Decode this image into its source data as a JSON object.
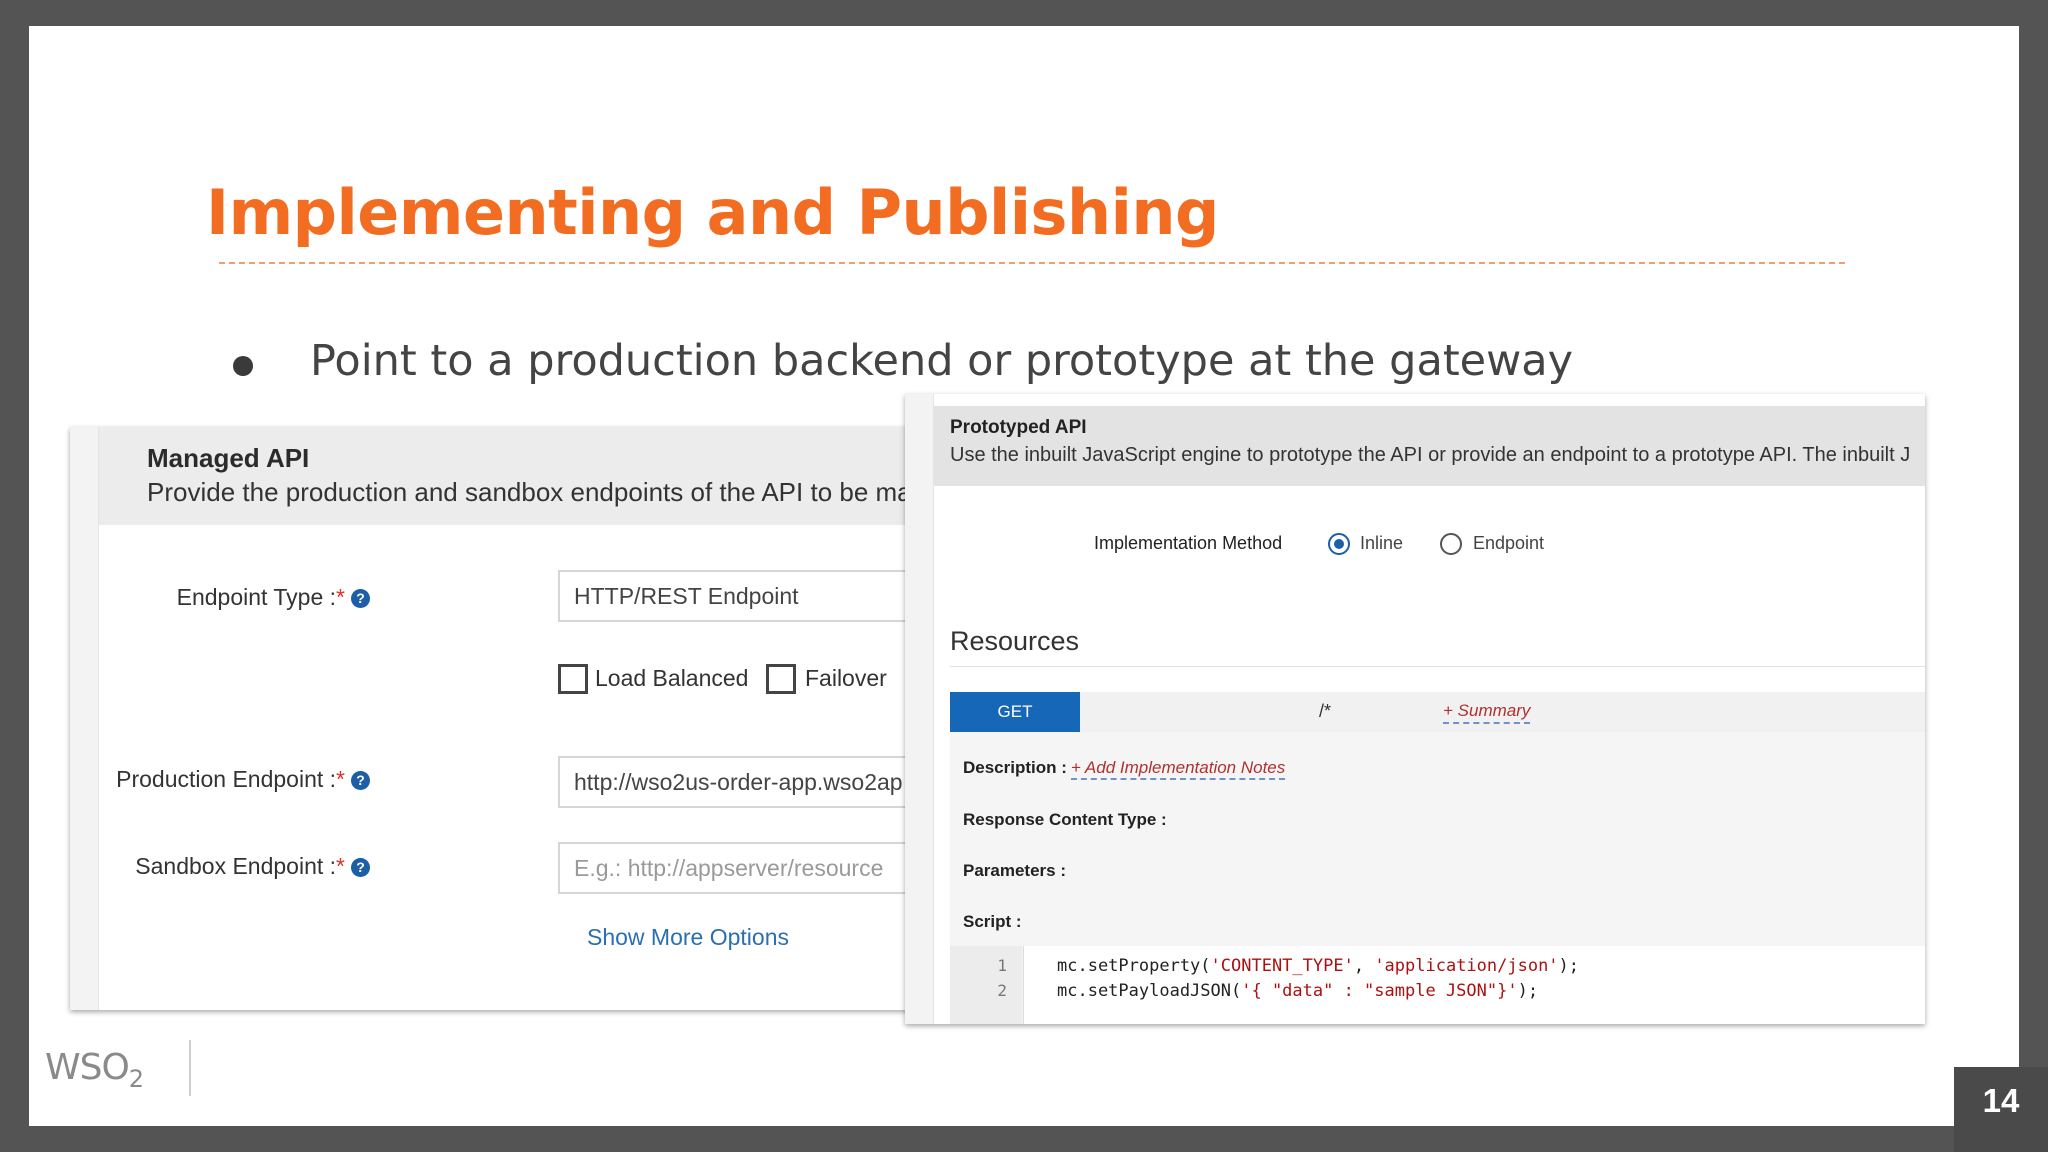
{
  "slide": {
    "title": "Implementing and Publishing",
    "bullet": "Point to a production backend or prototype at the gateway",
    "logo": "WSO",
    "logo_sub": "2",
    "page_number": "14"
  },
  "managed_api": {
    "title": "Managed API",
    "description": "Provide the production and sandbox endpoints of the API to be mana",
    "endpoint_type_label": "Endpoint Type :",
    "endpoint_type_value": "HTTP/REST Endpoint",
    "load_balanced_label": "Load Balanced",
    "failover_label": "Failover",
    "production_label": "Production Endpoint :",
    "production_value": "http://wso2us-order-app.wso2ap",
    "sandbox_label": "Sandbox Endpoint :",
    "sandbox_placeholder": "E.g.: http://appserver/resource",
    "show_more": "Show More Options",
    "required_mark": "*",
    "help_glyph": "?"
  },
  "prototyped_api": {
    "title": "Prototyped API",
    "description": "Use the inbuilt JavaScript engine to prototype the API or provide an endpoint to a prototype API. The inbuilt J",
    "impl_method_label": "Implementation Method",
    "option_inline": "Inline",
    "option_endpoint": "Endpoint",
    "selected_option": "Inline",
    "resources_title": "Resources",
    "method": "GET",
    "path": "/*",
    "summary_link": "+ Summary",
    "description_label": "Description :",
    "add_notes_link": "+ Add Implementation Notes",
    "response_type_label": "Response Content Type :",
    "parameters_label": "Parameters :",
    "script_label": "Script :",
    "code": [
      {
        "line": "1",
        "prefix": "mc.setProperty(",
        "s1": "'CONTENT_TYPE'",
        "mid": ", ",
        "s2": "'application/json'",
        "suffix": ");"
      },
      {
        "line": "2",
        "prefix": "mc.setPayloadJSON(",
        "s1": "'{ \"data\" : \"sample JSON\"}'",
        "mid": "",
        "s2": "",
        "suffix": ");"
      }
    ]
  }
}
